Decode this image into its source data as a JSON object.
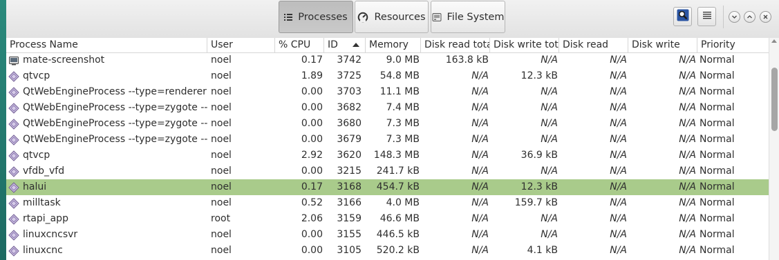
{
  "toolbar": {
    "tabs": [
      {
        "label": "Processes",
        "icon": "list-icon"
      },
      {
        "label": "Resources",
        "icon": "gauge-icon"
      },
      {
        "label": "File System",
        "icon": "drive-icon"
      }
    ],
    "active_tab": "Processes",
    "search_icon": "search-icon",
    "menu_icon": "hamburger-icon",
    "window_controls": [
      "minimize-icon",
      "maximize-icon",
      "close-icon"
    ]
  },
  "columns": {
    "name": "Process Name",
    "user": "User",
    "cpu": "% CPU",
    "id": "ID",
    "memory": "Memory",
    "disk_read_total": "Disk read total",
    "disk_write_total": "Disk write total",
    "disk_read": "Disk read",
    "disk_write": "Disk write",
    "priority": "Priority"
  },
  "sort": {
    "column": "ID",
    "direction": "ascending-indicator"
  },
  "colors": {
    "selected_row": "#a9cb8b",
    "active_tab": "#c3c3c3"
  },
  "processes": [
    {
      "icon": "screenshot-app-icon",
      "name": "mate-screenshot",
      "user": "noel",
      "cpu": "0.17",
      "id": "3742",
      "memory": "9.0 MB",
      "disk_read_total": "163.8 kB",
      "disk_write_total": "N/A",
      "disk_read": "N/A",
      "disk_write": "N/A",
      "priority": "Normal"
    },
    {
      "icon": "process-icon",
      "name": "qtvcp",
      "user": "noel",
      "cpu": "1.89",
      "id": "3725",
      "memory": "54.8 MB",
      "disk_read_total": "N/A",
      "disk_write_total": "12.3 kB",
      "disk_read": "N/A",
      "disk_write": "N/A",
      "priority": "Normal"
    },
    {
      "icon": "process-icon",
      "name": "QtWebEngineProcess --type=renderer --",
      "user": "noel",
      "cpu": "0.00",
      "id": "3703",
      "memory": "11.1 MB",
      "disk_read_total": "N/A",
      "disk_write_total": "N/A",
      "disk_read": "N/A",
      "disk_write": "N/A",
      "priority": "Normal"
    },
    {
      "icon": "process-icon",
      "name": "QtWebEngineProcess --type=zygote --ap",
      "user": "noel",
      "cpu": "0.00",
      "id": "3682",
      "memory": "7.4 MB",
      "disk_read_total": "N/A",
      "disk_write_total": "N/A",
      "disk_read": "N/A",
      "disk_write": "N/A",
      "priority": "Normal"
    },
    {
      "icon": "process-icon",
      "name": "QtWebEngineProcess --type=zygote --ap",
      "user": "noel",
      "cpu": "0.00",
      "id": "3680",
      "memory": "7.3 MB",
      "disk_read_total": "N/A",
      "disk_write_total": "N/A",
      "disk_read": "N/A",
      "disk_write": "N/A",
      "priority": "Normal"
    },
    {
      "icon": "process-icon",
      "name": "QtWebEngineProcess --type=zygote --no",
      "user": "noel",
      "cpu": "0.00",
      "id": "3679",
      "memory": "7.3 MB",
      "disk_read_total": "N/A",
      "disk_write_total": "N/A",
      "disk_read": "N/A",
      "disk_write": "N/A",
      "priority": "Normal"
    },
    {
      "icon": "process-icon",
      "name": "qtvcp",
      "user": "noel",
      "cpu": "2.92",
      "id": "3620",
      "memory": "148.3 MB",
      "disk_read_total": "N/A",
      "disk_write_total": "36.9 kB",
      "disk_read": "N/A",
      "disk_write": "N/A",
      "priority": "Normal"
    },
    {
      "icon": "process-icon",
      "name": "vfdb_vfd",
      "user": "noel",
      "cpu": "0.00",
      "id": "3215",
      "memory": "241.7 kB",
      "disk_read_total": "N/A",
      "disk_write_total": "N/A",
      "disk_read": "N/A",
      "disk_write": "N/A",
      "priority": "Normal"
    },
    {
      "icon": "process-icon",
      "name": "halui",
      "user": "noel",
      "cpu": "0.17",
      "id": "3168",
      "memory": "454.7 kB",
      "disk_read_total": "N/A",
      "disk_write_total": "12.3 kB",
      "disk_read": "N/A",
      "disk_write": "N/A",
      "priority": "Normal",
      "selected": true
    },
    {
      "icon": "process-icon",
      "name": "milltask",
      "user": "noel",
      "cpu": "0.52",
      "id": "3166",
      "memory": "4.0 MB",
      "disk_read_total": "N/A",
      "disk_write_total": "159.7 kB",
      "disk_read": "N/A",
      "disk_write": "N/A",
      "priority": "Normal"
    },
    {
      "icon": "process-icon",
      "name": "rtapi_app",
      "user": "root",
      "cpu": "2.06",
      "id": "3159",
      "memory": "46.6 MB",
      "disk_read_total": "N/A",
      "disk_write_total": "N/A",
      "disk_read": "N/A",
      "disk_write": "N/A",
      "priority": "Normal"
    },
    {
      "icon": "process-icon",
      "name": "linuxcncsvr",
      "user": "noel",
      "cpu": "0.00",
      "id": "3155",
      "memory": "446.5 kB",
      "disk_read_total": "N/A",
      "disk_write_total": "N/A",
      "disk_read": "N/A",
      "disk_write": "N/A",
      "priority": "Normal"
    },
    {
      "icon": "process-icon",
      "name": "linuxcnc",
      "user": "noel",
      "cpu": "0.00",
      "id": "3105",
      "memory": "520.2 kB",
      "disk_read_total": "N/A",
      "disk_write_total": "4.1 kB",
      "disk_read": "N/A",
      "disk_write": "N/A",
      "priority": "Normal"
    }
  ]
}
